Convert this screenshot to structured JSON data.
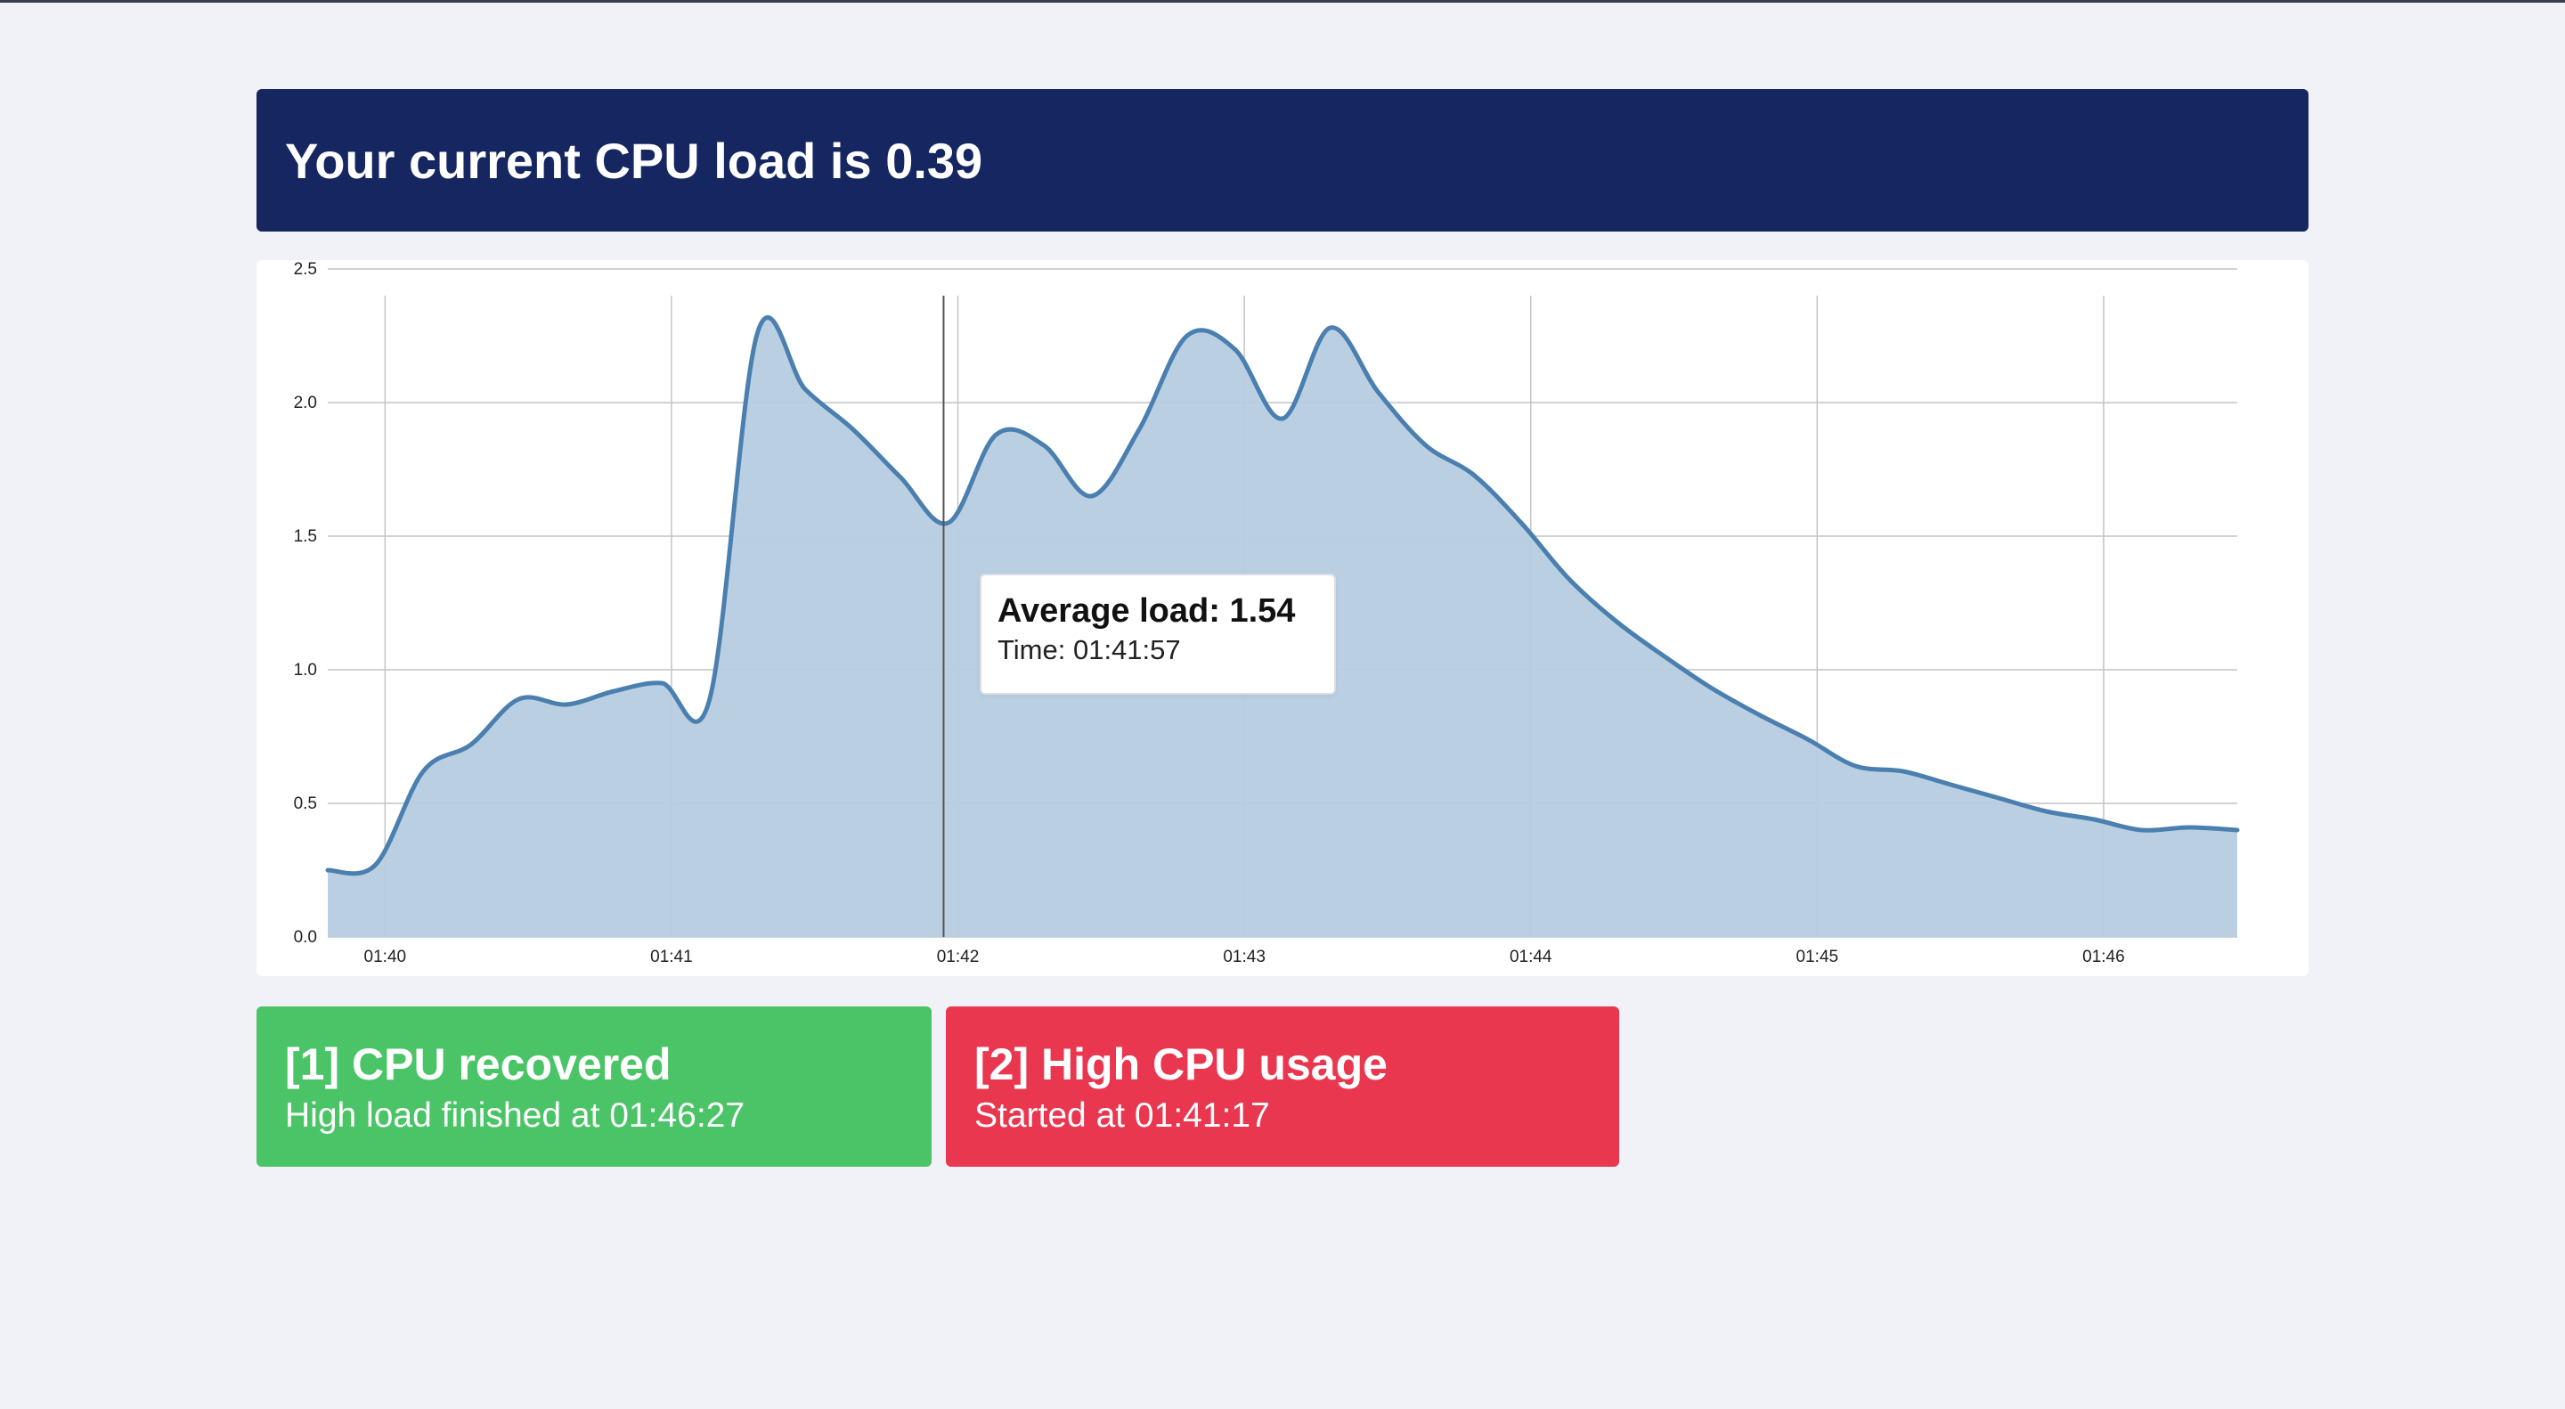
{
  "header": {
    "title": "Your current CPU load is 0.39"
  },
  "tooltip": {
    "value_label": "Average load: 1.54",
    "time_label": "Time: 01:41:57"
  },
  "alerts": [
    {
      "title": "[1] CPU recovered",
      "subtitle": "High load finished at 01:46:27",
      "status": "recovered",
      "color": "#4ac466"
    },
    {
      "title": "[2] High CPU usage",
      "subtitle": "Started at 01:41:17",
      "status": "high",
      "color": "#e9374f"
    }
  ],
  "colors": {
    "header_bg": "#152660",
    "line": "#4a7fb0",
    "area": "#b6cde0",
    "page_bg": "#f0f2f7"
  },
  "chart_data": {
    "type": "area",
    "title": "",
    "xlabel": "",
    "ylabel": "",
    "ylim": [
      0,
      2.5
    ],
    "xlim": [
      "01:39:48",
      "01:46:28"
    ],
    "y_ticks": [
      "0.0",
      "0.5",
      "1.0",
      "1.5",
      "2.0",
      "2.5"
    ],
    "x_ticks": [
      "01:40",
      "01:41",
      "01:42",
      "01:43",
      "01:44",
      "01:45",
      "01:46"
    ],
    "grid": true,
    "hover_time": "01:41:57",
    "series": [
      {
        "x": [
          "01:39:48",
          "01:39:58",
          "01:40:08",
          "01:40:18",
          "01:40:28",
          "01:40:38",
          "01:40:48",
          "01:40:58",
          "01:41:08",
          "01:41:18",
          "01:41:28",
          "01:41:38",
          "01:41:48",
          "01:41:58",
          "01:42:08",
          "01:42:18",
          "01:42:28",
          "01:42:38",
          "01:42:48",
          "01:42:58",
          "01:43:08",
          "01:43:18",
          "01:43:28",
          "01:43:38",
          "01:43:48",
          "01:43:58",
          "01:44:08",
          "01:44:18",
          "01:44:28",
          "01:44:38",
          "01:44:48",
          "01:44:58",
          "01:45:08",
          "01:45:18",
          "01:45:28",
          "01:45:38",
          "01:45:48",
          "01:45:58",
          "01:46:08",
          "01:46:18",
          "01:46:28"
        ],
        "values": [
          0.25,
          0.27,
          0.62,
          0.72,
          0.89,
          0.87,
          0.92,
          0.95,
          0.89,
          2.26,
          2.05,
          1.9,
          1.72,
          1.55,
          1.88,
          1.84,
          1.65,
          1.9,
          2.25,
          2.2,
          1.94,
          2.28,
          2.04,
          1.84,
          1.73,
          1.55,
          1.34,
          1.18,
          1.05,
          0.93,
          0.83,
          0.74,
          0.64,
          0.62,
          0.57,
          0.52,
          0.47,
          0.44,
          0.4,
          0.41,
          0.4
        ]
      }
    ]
  }
}
